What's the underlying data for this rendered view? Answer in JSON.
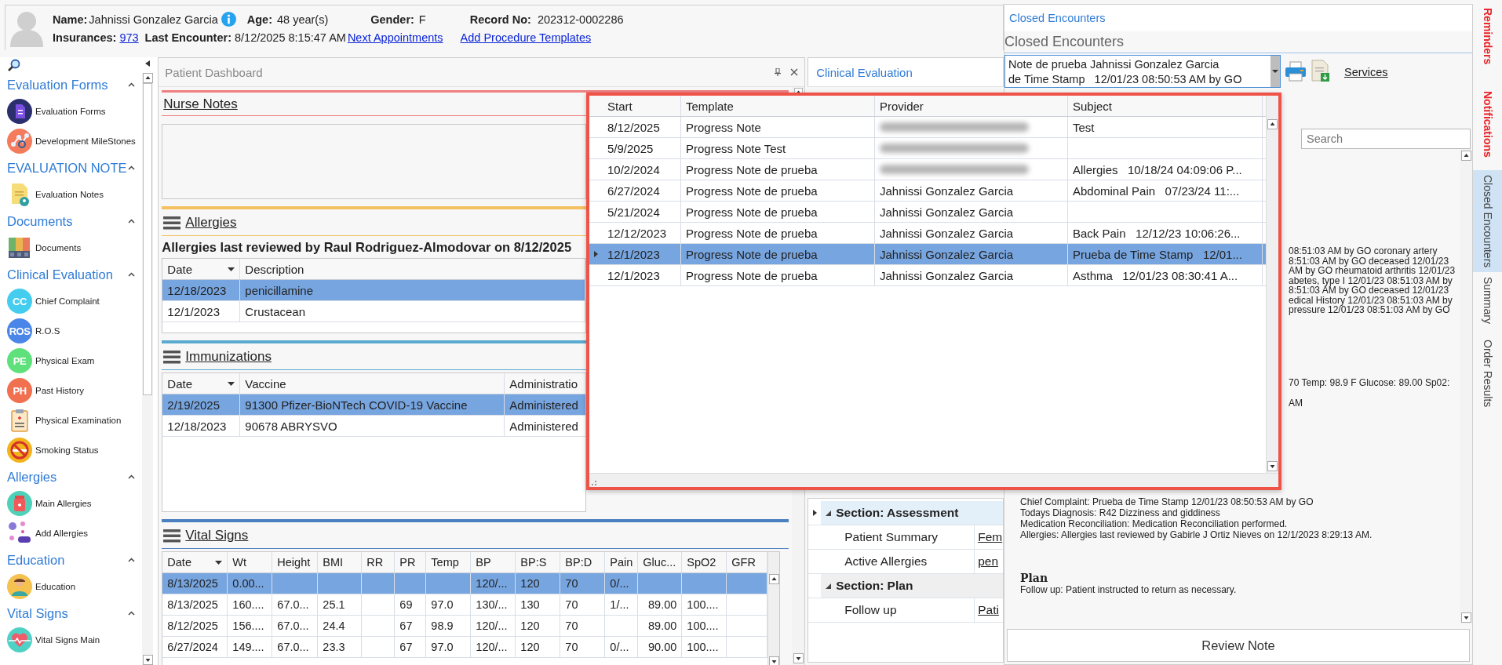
{
  "header": {
    "name_label": "Name:",
    "name": "Jahnissi Gonzalez Garcia",
    "age_label": "Age:",
    "age": "48 year(s)",
    "gender_label": "Gender:",
    "gender": "F",
    "record_label": "Record No:",
    "record": "202312-0002286",
    "insurances_label": "Insurances:",
    "insurances": "973",
    "last_encounter_label": "Last Encounter:",
    "last_encounter": "8/12/2025 8:15:47 AM",
    "links": [
      "Next Appointments",
      "Add Procedure Templates"
    ]
  },
  "sidebar": {
    "groups": [
      {
        "title": "Evaluation Forms",
        "expanded": true,
        "items": [
          {
            "label": "Evaluation Forms"
          },
          {
            "label": "Development MileStones"
          }
        ]
      },
      {
        "title": "EVALUATION NOTE",
        "expanded": true,
        "items": [
          {
            "label": "Evaluation Notes"
          }
        ]
      },
      {
        "title": "Documents",
        "expanded": true,
        "items": [
          {
            "label": "Documents"
          }
        ]
      },
      {
        "title": "Clinical Evaluation",
        "expanded": true,
        "items": [
          {
            "label": "Chief Complaint",
            "badge": "CC",
            "color": "#45cdf0"
          },
          {
            "label": "R.O.S",
            "badge": "ROS",
            "color": "#4a86e8"
          },
          {
            "label": "Physical Exam",
            "badge": "PE",
            "color": "#5ee07a"
          },
          {
            "label": "Past History",
            "badge": "PH",
            "color": "#f0704f"
          },
          {
            "label": "Physical Examination"
          },
          {
            "label": "Smoking Status"
          }
        ]
      },
      {
        "title": "Allergies",
        "expanded": true,
        "items": [
          {
            "label": "Main Allergies"
          },
          {
            "label": "Add Allergies"
          }
        ]
      },
      {
        "title": "Education",
        "expanded": true,
        "items": [
          {
            "label": "Education"
          }
        ]
      },
      {
        "title": "Vital Signs",
        "expanded": true,
        "items": [
          {
            "label": "Vital Signs Main"
          }
        ]
      }
    ]
  },
  "dashboard": {
    "title": "Patient Dashboard",
    "nurse_notes": {
      "title": "Nurse Notes"
    },
    "allergies": {
      "title": "Allergies",
      "reviewed": "Allergies last reviewed by Raul Rodriguez-Almodovar on 8/12/2025",
      "columns": [
        "Date",
        "Description"
      ],
      "rows": [
        {
          "cells": [
            "12/18/2023",
            "penicillamine"
          ],
          "selected": true
        },
        {
          "cells": [
            "12/1/2023",
            "Crustacean"
          ],
          "selected": false
        }
      ]
    },
    "immunizations": {
      "title": "Immunizations",
      "columns": [
        "Date",
        "Vaccine",
        "Administratio"
      ],
      "rows": [
        {
          "cells": [
            "2/19/2025",
            "91300 Pfizer-BioNTech COVID-19 Vaccine",
            "Administered"
          ],
          "selected": true
        },
        {
          "cells": [
            "12/18/2023",
            "90678 ABRYSVO",
            "Administered"
          ],
          "selected": false
        }
      ]
    },
    "vital_signs": {
      "title": "Vital Signs",
      "columns": [
        "Date",
        "Wt",
        "Height",
        "BMI",
        "RR",
        "PR",
        "Temp",
        "BP",
        "BP:S",
        "BP:D",
        "Pain",
        "Gluc...",
        "SpO2",
        "GFR"
      ],
      "rows": [
        {
          "cells": [
            "8/13/2025",
            "0.00...",
            null,
            null,
            null,
            null,
            null,
            "120/...",
            "120",
            "70",
            "0/...",
            null,
            null,
            null
          ],
          "selected": true
        },
        {
          "cells": [
            "8/13/2025",
            "160....",
            "67.0...",
            "25.1",
            null,
            "69",
            "97.0",
            "130/...",
            "130",
            "70",
            "1/...",
            "89.00",
            "100....",
            null
          ],
          "selected": false
        },
        {
          "cells": [
            "8/12/2025",
            "156....",
            "67.0...",
            "24.4",
            null,
            "67",
            "98.9",
            "120/...",
            "120",
            "70",
            null,
            "89.00",
            "100....",
            null
          ],
          "selected": false
        },
        {
          "cells": [
            "6/27/2024",
            "149....",
            "67.0...",
            "23.3",
            null,
            "67",
            "97.0",
            "120/...",
            "120",
            "70",
            "0/...",
            "90.00",
            "100....",
            null
          ],
          "selected": false
        }
      ]
    }
  },
  "clinical": {
    "title": "Clinical Evaluation",
    "sections": [
      {
        "label": "Section: Assessment",
        "selected": true,
        "expanded": true,
        "children": [
          {
            "label": "Patient Summary",
            "value": "Fem"
          },
          {
            "label": "Active Allergies",
            "value": "pen"
          }
        ]
      },
      {
        "label": "Section: Plan",
        "selected": false,
        "expanded": true,
        "children": [
          {
            "label": "Follow up",
            "value": "Pati"
          }
        ]
      }
    ]
  },
  "encounters_popup": {
    "columns": [
      "Start",
      "Template",
      "Provider",
      "Subject"
    ],
    "rows": [
      {
        "cells": [
          "8/12/2025",
          "Progress Note",
          null,
          "Test"
        ],
        "blurred": true,
        "selected": false
      },
      {
        "cells": [
          "5/9/2025",
          "Progress Note Test",
          null,
          null
        ],
        "blurred": true,
        "selected": false
      },
      {
        "cells": [
          "10/2/2024",
          "Progress Note de prueba",
          null,
          "Allergies   10/18/24 04:09:06 P..."
        ],
        "blurred": true,
        "selected": false
      },
      {
        "cells": [
          "6/27/2024",
          "Progress Note de prueba",
          "Jahnissi Gonzalez Garcia",
          "Abdominal Pain   07/23/24 11:..."
        ],
        "blurred": false,
        "selected": false
      },
      {
        "cells": [
          "5/21/2024",
          "Progress Note de prueba",
          "Jahnissi Gonzalez Garcia",
          null
        ],
        "blurred": false,
        "selected": false
      },
      {
        "cells": [
          "12/12/2023",
          "Progress Note de prueba",
          "Jahnissi Gonzalez Garcia",
          "Back Pain   12/12/23 10:06:26..."
        ],
        "blurred": false,
        "selected": false
      },
      {
        "cells": [
          "12/1/2023",
          "Progress Note de prueba",
          "Jahnissi Gonzalez Garcia",
          "Prueba de Time Stamp   12/01..."
        ],
        "blurred": false,
        "selected": true
      },
      {
        "cells": [
          "12/1/2023",
          "Progress Note de prueba",
          "Jahnissi Gonzalez Garcia",
          "Asthma   12/01/23 08:30:41 A..."
        ],
        "blurred": false,
        "selected": false
      }
    ]
  },
  "closed_encounters": {
    "tab_title": "Closed Encounters",
    "heading": "Closed Encounters",
    "dropdown_lines": [
      "Note de prueba Jahnissi Gonzalez Garcia",
      "de Time Stamp   12/01/23 08:50:53 AM by GO"
    ],
    "services_link": "Services",
    "search": {
      "placeholder": "Search"
    },
    "note": {
      "fragments": [
        "08:51:03 AM by GO coronary artery",
        "8:51:03 AM by GO deceased 12/01/23",
        "AM by GO rheumatoid arthritis 12/01/23",
        "abetes, type I 12/01/23 08:51:03 AM by",
        "8:51:03 AM by GO deceased 12/01/23",
        "edical History 12/01/23 08:51:03 AM by",
        "pressure 12/01/23 08:51:03 AM by GO"
      ],
      "vitals_fragments": [
        "70 Temp: 98.9 F Glucose: 89.00 Sp02:",
        "AM"
      ],
      "lines": [
        "Chief Complaint: Prueba de Time Stamp 12/01/23 08:50:53 AM by GO",
        "Todays Diagnosis: R42 Dizziness and giddiness",
        "Medication Reconciliation: Medication Reconciliation performed.",
        "Allergies: Allergies last reviewed by Gabirle J Ortiz Nieves on 12/1/2023 8:29:13 AM."
      ],
      "plan_heading": "Plan",
      "plan_text": "Follow up: Patient instructed to return as necessary."
    },
    "review_button": "Review Note"
  },
  "side_tabs": [
    {
      "label": "Reminders",
      "color": "#e8262b",
      "selected": false
    },
    {
      "label": "Notifications",
      "color": "#e8262b",
      "selected": false
    },
    {
      "label": "Closed Encounters",
      "color": "#444444",
      "selected": true
    },
    {
      "label": "Summary",
      "color": "#444444",
      "selected": false
    },
    {
      "label": "Order Results",
      "color": "#444444",
      "selected": false
    }
  ]
}
